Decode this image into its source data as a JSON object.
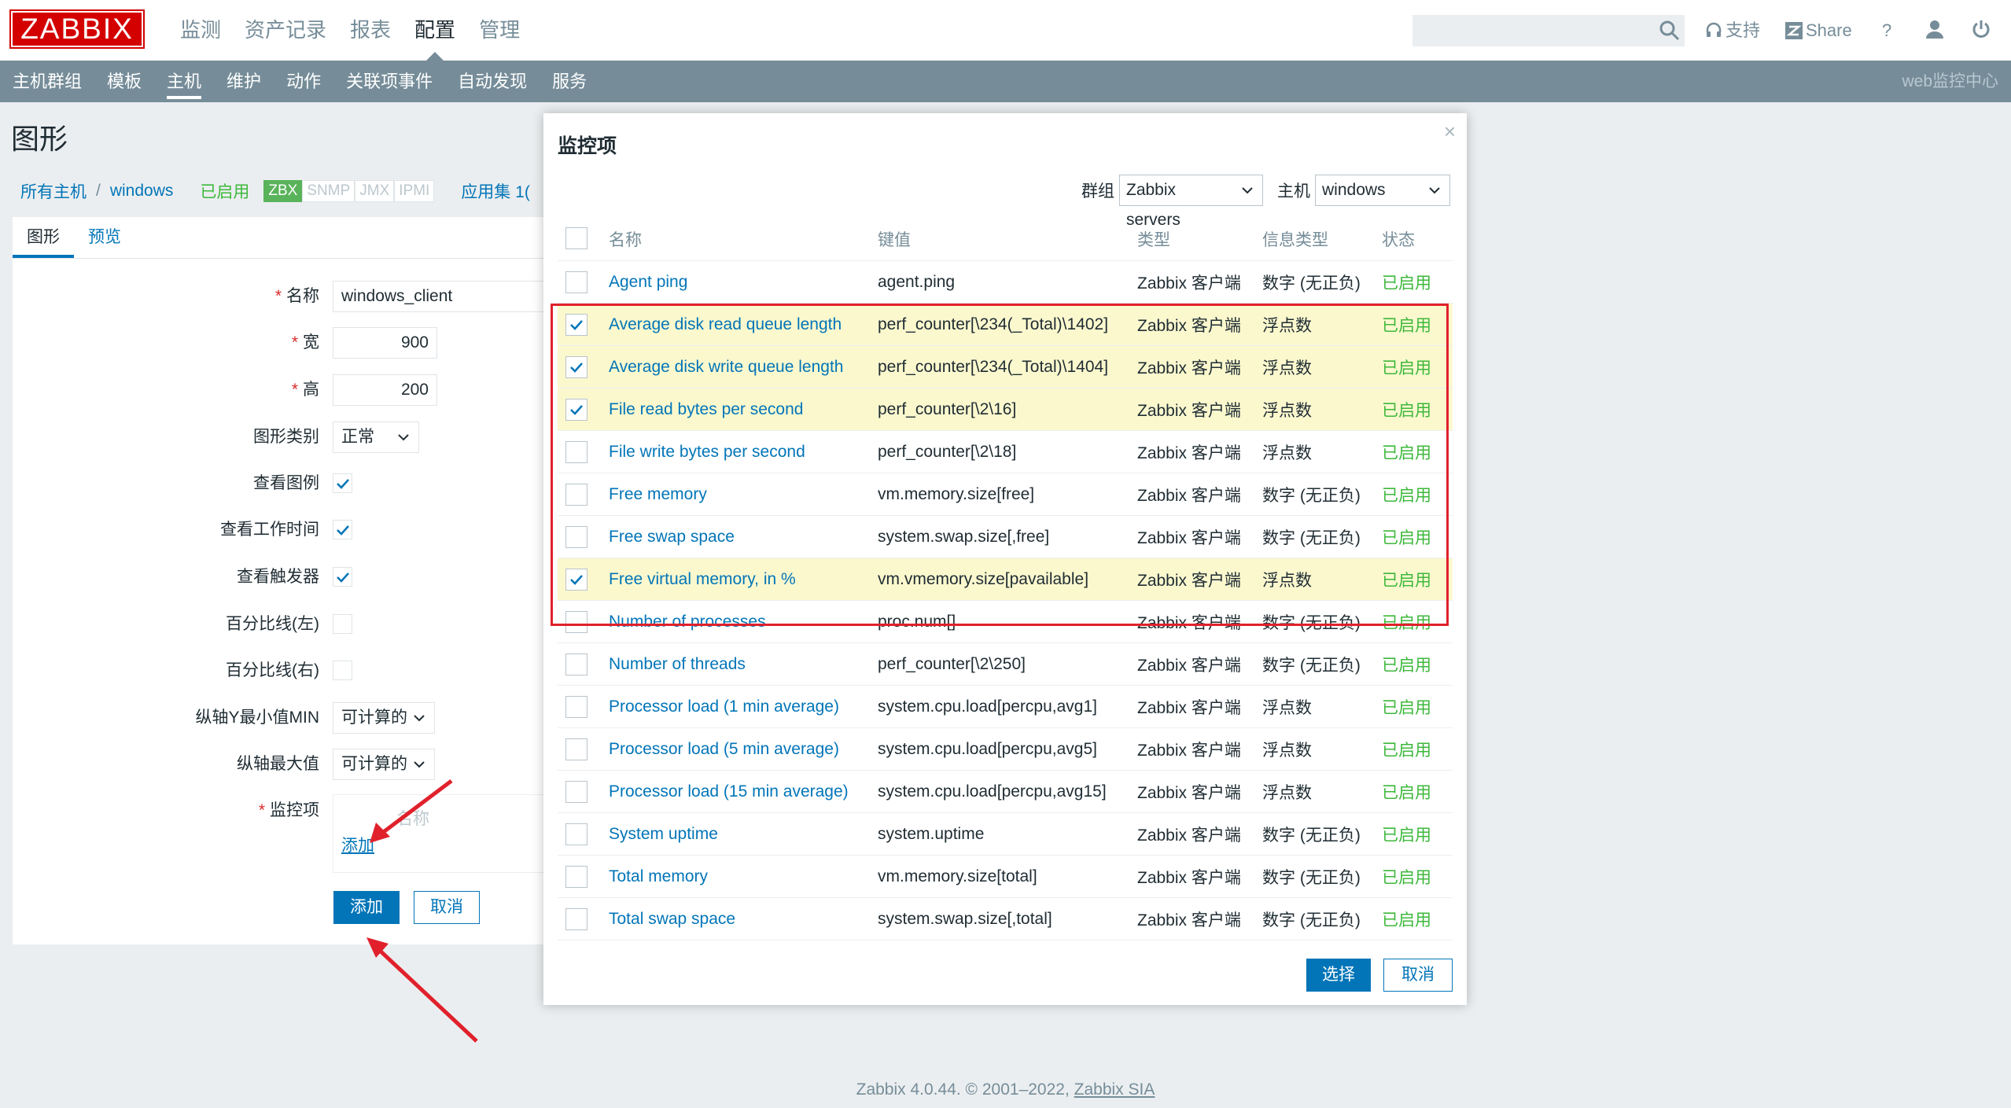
{
  "header": {
    "logo": "ZABBIX",
    "menu": [
      "监测",
      "资产记录",
      "报表",
      "配置",
      "管理"
    ],
    "active_menu": "配置",
    "support": "支持",
    "share": "Share",
    "help": "?"
  },
  "subnav": {
    "items": [
      "主机群组",
      "模板",
      "主机",
      "维护",
      "动作",
      "关联项事件",
      "自动发现",
      "服务"
    ],
    "active": "主机",
    "server_name": "web监控中心"
  },
  "page": {
    "title": "图形",
    "breadcrumbs": {
      "all_hosts": "所有主机",
      "separator": "/",
      "host": "windows",
      "status": "已启用",
      "badges": [
        "ZBX",
        "SNMP",
        "JMX",
        "IPMI"
      ],
      "apps": "应用集 1("
    },
    "tabs": [
      "图形",
      "预览"
    ],
    "form": {
      "name_label": "名称",
      "name_value": "windows_client",
      "width_label": "宽",
      "width_value": "900",
      "height_label": "高",
      "height_value": "200",
      "graph_type_label": "图形类别",
      "graph_type_value": "正常",
      "show_legend_label": "查看图例",
      "show_worktime_label": "查看工作时间",
      "show_triggers_label": "查看触发器",
      "percent_left_label": "百分比线(左)",
      "percent_right_label": "百分比线(右)",
      "ymin_label": "纵轴Y最小值MIN",
      "ymin_value": "可计算的",
      "ymax_label": "纵轴最大值",
      "ymax_value": "可计算的",
      "items_label": "监控项",
      "items_ghost": "名称",
      "items_add": "添加",
      "add_button": "添加",
      "cancel_button": "取消"
    }
  },
  "footer": {
    "text": "Zabbix 4.0.44. © 2001–2022, ",
    "link": "Zabbix SIA"
  },
  "modal": {
    "title": "监控项",
    "close": "×",
    "group_label": "群组",
    "group_value": "Zabbix servers",
    "host_label": "主机",
    "host_value": "windows",
    "columns": [
      "名称",
      "键值",
      "类型",
      "信息类型",
      "状态"
    ],
    "rows": [
      {
        "name": "Agent ping",
        "key": "agent.ping",
        "type": "Zabbix 客户端",
        "info": "数字 (无正负)",
        "status": "已启用",
        "checked": false
      },
      {
        "name": "Average disk read queue length",
        "key": "perf_counter[\\234(_Total)\\1402]",
        "type": "Zabbix 客户端",
        "info": "浮点数",
        "status": "已启用",
        "checked": true
      },
      {
        "name": "Average disk write queue length",
        "key": "perf_counter[\\234(_Total)\\1404]",
        "type": "Zabbix 客户端",
        "info": "浮点数",
        "status": "已启用",
        "checked": true
      },
      {
        "name": "File read bytes per second",
        "key": "perf_counter[\\2\\16]",
        "type": "Zabbix 客户端",
        "info": "浮点数",
        "status": "已启用",
        "checked": true
      },
      {
        "name": "File write bytes per second",
        "key": "perf_counter[\\2\\18]",
        "type": "Zabbix 客户端",
        "info": "浮点数",
        "status": "已启用",
        "checked": false
      },
      {
        "name": "Free memory",
        "key": "vm.memory.size[free]",
        "type": "Zabbix 客户端",
        "info": "数字 (无正负)",
        "status": "已启用",
        "checked": false
      },
      {
        "name": "Free swap space",
        "key": "system.swap.size[,free]",
        "type": "Zabbix 客户端",
        "info": "数字 (无正负)",
        "status": "已启用",
        "checked": false
      },
      {
        "name": "Free virtual memory, in %",
        "key": "vm.vmemory.size[pavailable]",
        "type": "Zabbix 客户端",
        "info": "浮点数",
        "status": "已启用",
        "checked": true
      },
      {
        "name": "Number of processes",
        "key": "proc.num[]",
        "type": "Zabbix 客户端",
        "info": "数字 (无正负)",
        "status": "已启用",
        "checked": false
      },
      {
        "name": "Number of threads",
        "key": "perf_counter[\\2\\250]",
        "type": "Zabbix 客户端",
        "info": "数字 (无正负)",
        "status": "已启用",
        "checked": false
      },
      {
        "name": "Processor load (1 min average)",
        "key": "system.cpu.load[percpu,avg1]",
        "type": "Zabbix 客户端",
        "info": "浮点数",
        "status": "已启用",
        "checked": false
      },
      {
        "name": "Processor load (5 min average)",
        "key": "system.cpu.load[percpu,avg5]",
        "type": "Zabbix 客户端",
        "info": "浮点数",
        "status": "已启用",
        "checked": false
      },
      {
        "name": "Processor load (15 min average)",
        "key": "system.cpu.load[percpu,avg15]",
        "type": "Zabbix 客户端",
        "info": "浮点数",
        "status": "已启用",
        "checked": false
      },
      {
        "name": "System uptime",
        "key": "system.uptime",
        "type": "Zabbix 客户端",
        "info": "数字 (无正负)",
        "status": "已启用",
        "checked": false
      },
      {
        "name": "Total memory",
        "key": "vm.memory.size[total]",
        "type": "Zabbix 客户端",
        "info": "数字 (无正负)",
        "status": "已启用",
        "checked": false
      },
      {
        "name": "Total swap space",
        "key": "system.swap.size[,total]",
        "type": "Zabbix 客户端",
        "info": "数字 (无正负)",
        "status": "已启用",
        "checked": false
      }
    ],
    "select_button": "选择",
    "cancel_button": "取消"
  },
  "colors": {
    "brand_red": "#d40000",
    "accent_blue": "#0275b8",
    "subnav_bg": "#768d99",
    "status_green": "#3db83b",
    "row_highlight": "#fbf8ce",
    "annotation_red": "#e0212b"
  }
}
